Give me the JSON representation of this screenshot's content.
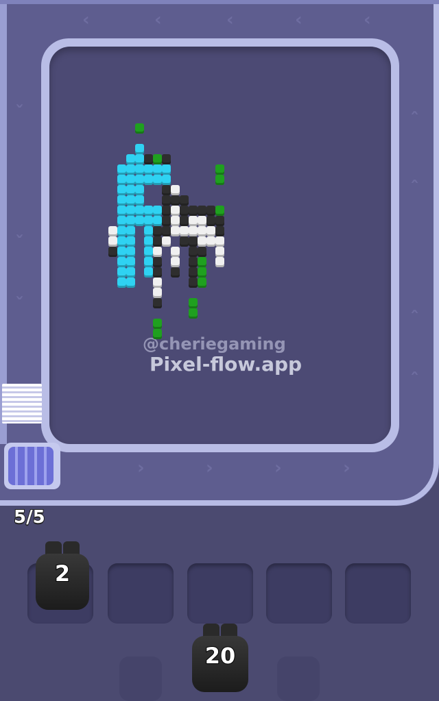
{
  "game": {
    "watermark_handle": "@cheriegaming",
    "watermark_site": "Pixel-flow.app",
    "queue_counter": "5/5",
    "shooters": [
      {
        "count": "2",
        "color": "#2a2a2a"
      },
      {
        "count": "20",
        "color": "#2a2a2a"
      }
    ],
    "slot_count": 5,
    "palette": {
      "cyan": "#2fd2f2",
      "black": "#2e2e2e",
      "white": "#f0f0f0",
      "green": "#1fa01f"
    }
  }
}
